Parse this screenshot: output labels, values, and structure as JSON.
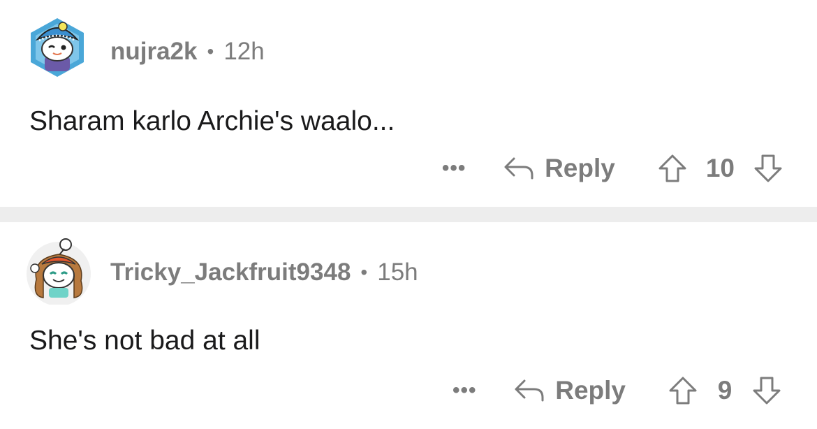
{
  "comments": [
    {
      "username": "nujra2k",
      "separator": "•",
      "time": "12h",
      "text": "Sharam karlo Archie's waalo...",
      "more_label": "•••",
      "reply_label": "Reply",
      "score": "10"
    },
    {
      "username": "Tricky_Jackfruit9348",
      "separator": "•",
      "time": "15h",
      "text": "She's not bad at all",
      "more_label": "•••",
      "reply_label": "Reply",
      "score": "9"
    }
  ],
  "colors": {
    "muted": "#7c7c7c",
    "text": "#1a1a1b",
    "divider": "#ededed"
  },
  "icons": [
    "avatar-snoo-turban",
    "avatar-snoo-girl",
    "more-dots-icon",
    "reply-arrow-icon",
    "upvote-arrow-icon",
    "downvote-arrow-icon"
  ]
}
